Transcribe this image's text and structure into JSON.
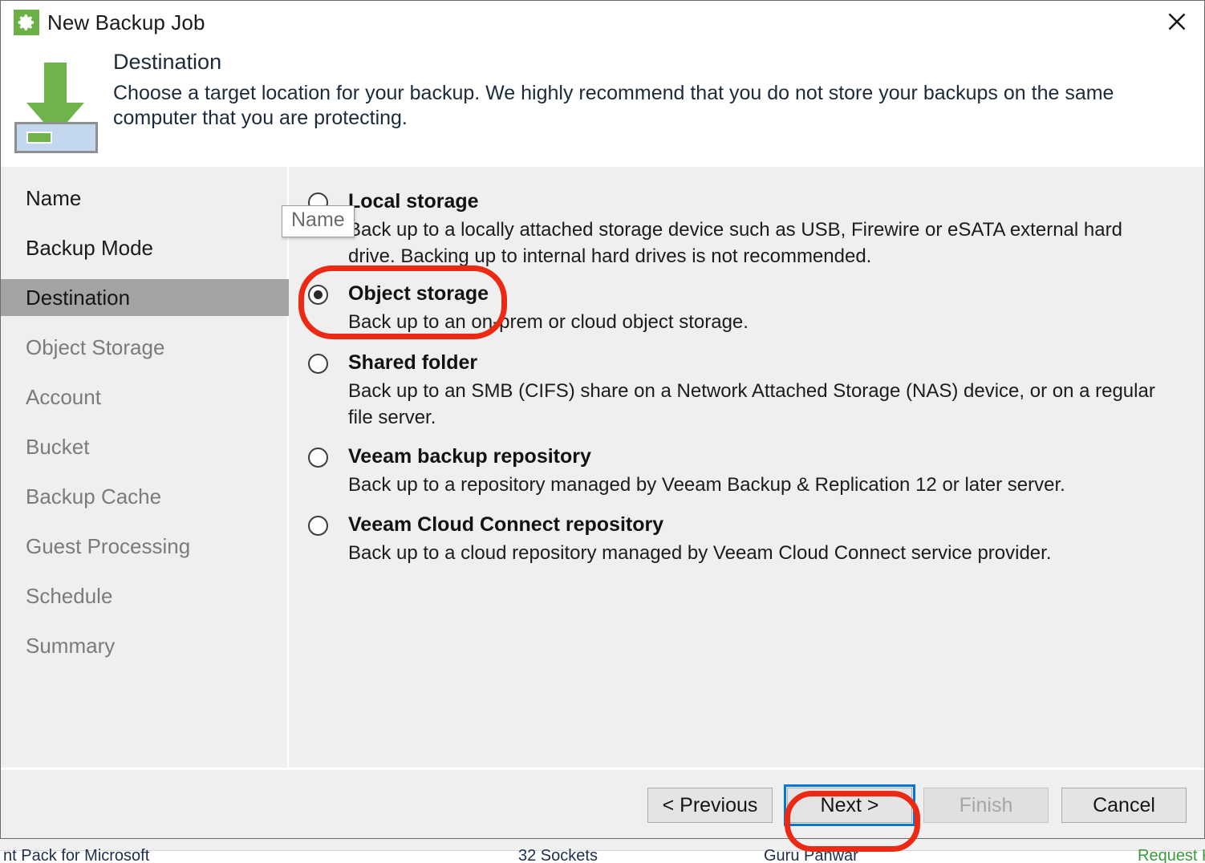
{
  "window": {
    "title": "New Backup Job",
    "title_icon": "gear-icon",
    "close_icon": "close-icon"
  },
  "banner": {
    "icon": "download-to-storage-icon",
    "title": "Destination",
    "subtitle": "Choose a target location for your backup. We highly recommend that you do not store your backups on the same computer that you are protecting."
  },
  "sidebar": {
    "items": [
      {
        "label": "Name",
        "state": "done"
      },
      {
        "label": "Backup Mode",
        "state": "done"
      },
      {
        "label": "Destination",
        "state": "active"
      },
      {
        "label": "Object Storage",
        "state": "pending"
      },
      {
        "label": "Account",
        "state": "pending"
      },
      {
        "label": "Bucket",
        "state": "pending"
      },
      {
        "label": "Backup Cache",
        "state": "pending"
      },
      {
        "label": "Guest Processing",
        "state": "pending"
      },
      {
        "label": "Schedule",
        "state": "pending"
      },
      {
        "label": "Summary",
        "state": "pending"
      }
    ]
  },
  "tooltip": {
    "text": "Name"
  },
  "options": [
    {
      "label": "Local storage",
      "description": "Back up to a locally attached storage device such as USB, Firewire or eSATA external hard drive. Backing up to internal hard drives is not recommended.",
      "selected": false
    },
    {
      "label": "Object storage",
      "description": "Back up to an on-prem or cloud object storage.",
      "selected": true
    },
    {
      "label": "Shared folder",
      "description": "Back up to an SMB (CIFS) share on a Network Attached Storage (NAS) device, or on a regular file server.",
      "selected": false
    },
    {
      "label": "Veeam backup repository",
      "description": "Back up to a repository managed by Veeam Backup & Replication 12 or later server.",
      "selected": false
    },
    {
      "label": "Veeam Cloud Connect repository",
      "description": "Back up to a cloud repository managed by Veeam Cloud Connect service provider.",
      "selected": false
    }
  ],
  "footer": {
    "previous_label": "< Previous",
    "next_label": "Next >",
    "finish_label": "Finish",
    "cancel_label": "Cancel"
  },
  "background_window": {
    "cells": [
      "nt Pack for Microsoft",
      "32 Sockets",
      "Guru Panwar",
      "Request Key"
    ]
  },
  "colors": {
    "accent_green": "#69b145",
    "annotation_red": "#ec2a14",
    "focus_blue": "#0078d7",
    "panel_bg": "#efefef",
    "active_nav_bg": "#a3a3a3"
  }
}
